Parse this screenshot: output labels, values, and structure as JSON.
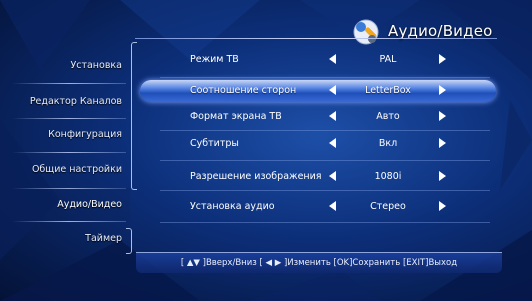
{
  "header": {
    "title": "Аудио/Видео",
    "icon": "wrench-settings-icon"
  },
  "sidebar": {
    "items": [
      {
        "label": "Установка"
      },
      {
        "label": "Редактор Каналов"
      },
      {
        "label": "Конфигурация"
      },
      {
        "label": "Общие настройки"
      },
      {
        "label": "Аудио/Видео"
      },
      {
        "label": "Таймер"
      }
    ],
    "active": "Аудио/Видео"
  },
  "settings": [
    {
      "label": "Режим ТВ",
      "value": "PAL"
    },
    {
      "label": "Соотношение сторон",
      "value": "LetterBox"
    },
    {
      "label": "Формат экрана ТВ",
      "value": "Авто"
    },
    {
      "label": "Субтитры",
      "value": "Вкл"
    },
    {
      "label": "Разрешение изображения",
      "value": "1080i"
    },
    {
      "label": "Установка аудио",
      "value": "Стерео"
    }
  ],
  "selected_setting": "Соотношение сторон",
  "status_bar": {
    "text": "[ ▲▼ ]Вверх/Вниз [ ◀ ▶ ]Изменить [OK]Сохранить [EXIT]Выход"
  },
  "colors": {
    "background": "#0c2e78",
    "highlight": "#4f7ee0",
    "text": "#ffffff"
  }
}
